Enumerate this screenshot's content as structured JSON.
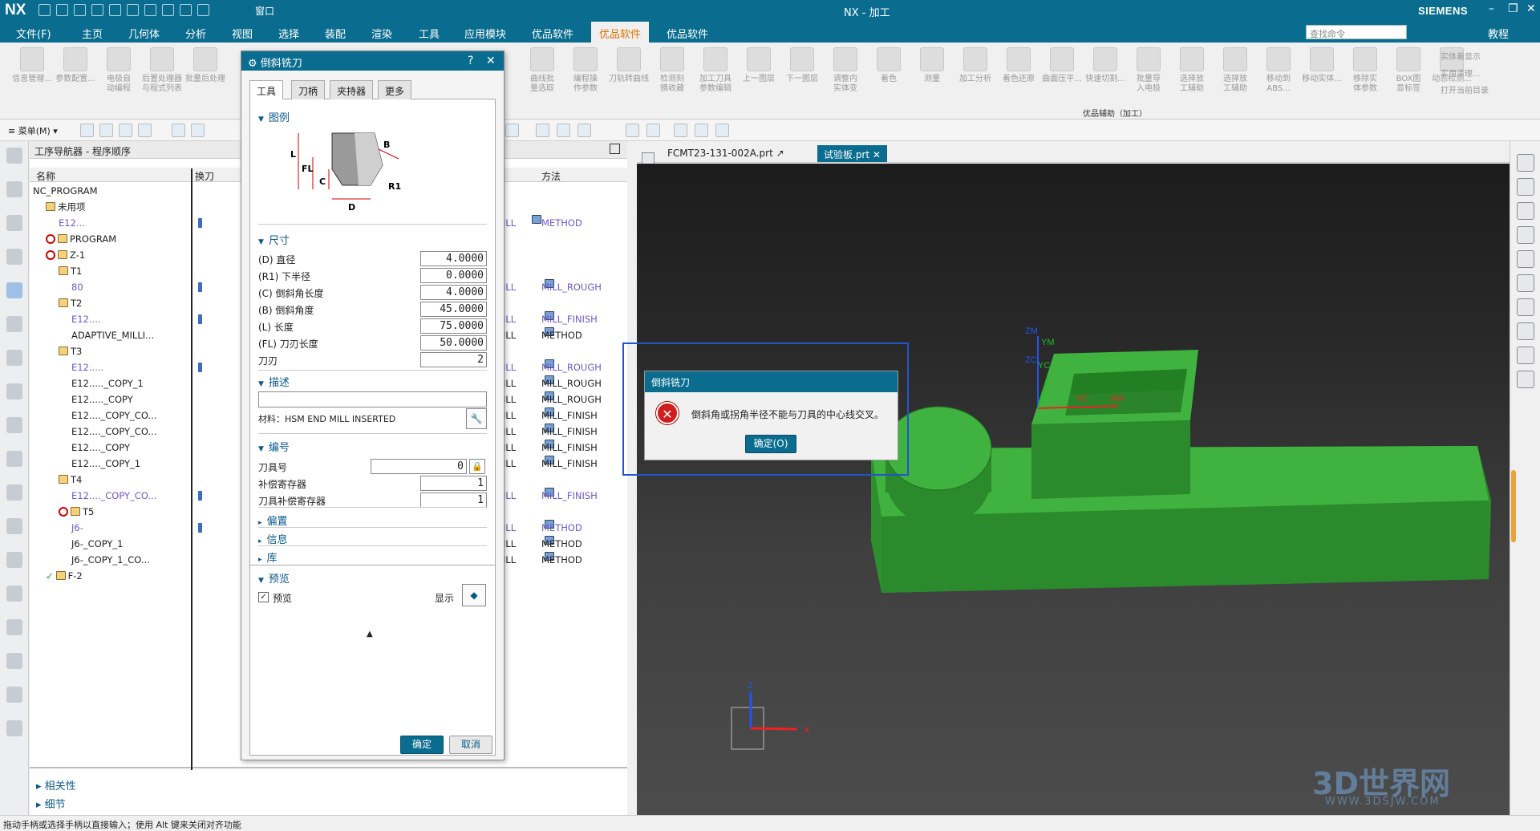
{
  "titlebar": {
    "logo": "NX",
    "window_menu": "窗口",
    "app_title": "NX - 加工",
    "brand": "SIEMENS"
  },
  "menubar": {
    "items": [
      "文件(F)",
      "主页",
      "几何体",
      "分析",
      "视图",
      "选择",
      "装配",
      "渲染",
      "工具",
      "应用模块",
      "优品软件",
      "优品软件",
      "优品软件"
    ],
    "search_placeholder": "查找命令",
    "tutorial": "教程"
  },
  "ribbon": {
    "left_buttons": [
      {
        "label": "信息管理..."
      },
      {
        "label": "参数配置..."
      },
      {
        "label": "电极自\n动编程"
      },
      {
        "label": "后置处理器\n与程式列表"
      },
      {
        "label": "批量后处理"
      }
    ],
    "right_buttons": [
      {
        "label": "曲线批\n量选取"
      },
      {
        "label": "编程操\n作参数"
      },
      {
        "label": "刀轨转曲线"
      },
      {
        "label": "检测刻\n摘收藏"
      },
      {
        "label": "加工刀具\n参数编辑"
      },
      {
        "label": "上一图层"
      },
      {
        "label": "下一图层"
      },
      {
        "label": "调整内\n实体变"
      },
      {
        "label": "着色"
      },
      {
        "label": "测量"
      },
      {
        "label": "加工分析"
      },
      {
        "label": "着色还原"
      },
      {
        "label": "曲面压平..."
      },
      {
        "label": "快速切割..."
      },
      {
        "label": "批量导\n入电极"
      },
      {
        "label": "选择放\n工辅助"
      },
      {
        "label": "选择放\n工辅助"
      },
      {
        "label": "移动到ABS..."
      },
      {
        "label": "移动实体..."
      },
      {
        "label": "移除实\n体参数"
      },
      {
        "label": "BOX图\n显标签"
      },
      {
        "label": "动态检测..."
      }
    ],
    "side_items": [
      "实体着显示",
      "实用清理...",
      "打开当前目录"
    ],
    "group_label": "优品辅助（加工）"
  },
  "toolbar2": {
    "menu_label": "菜单(M)"
  },
  "navigator": {
    "title": "工序导航器 - 程序顺序",
    "col_name": "名称",
    "col_toolchange": "换刀",
    "col_method": "方法",
    "rows": [
      {
        "indent": 0,
        "name": "NC_PROGRAM",
        "icon": "none",
        "op": "",
        "method": ""
      },
      {
        "indent": 1,
        "name": "未用项",
        "icon": "folder",
        "op": "",
        "method": ""
      },
      {
        "indent": 2,
        "name": "E12...",
        "icon": "op",
        "blue": true,
        "tc": true,
        "op": "ILL",
        "method": "METHOD",
        "mblue": true
      },
      {
        "indent": 1,
        "name": "PROGRAM",
        "icon": "stopfolder",
        "op": "",
        "method": ""
      },
      {
        "indent": 1,
        "name": "Z-1",
        "icon": "stopfolder",
        "op": "",
        "method": ""
      },
      {
        "indent": 2,
        "name": "T1",
        "icon": "folder",
        "op": "",
        "method": ""
      },
      {
        "indent": 3,
        "name": "80",
        "icon": "op",
        "blue": true,
        "tc": true,
        "op": "ILL",
        "method": "MILL_ROUGH",
        "mblue": true
      },
      {
        "indent": 2,
        "name": "T2",
        "icon": "folder",
        "op": "",
        "method": ""
      },
      {
        "indent": 3,
        "name": "E12....",
        "icon": "op",
        "blue": true,
        "tc": true,
        "op": "ILL",
        "method": "MILL_FINISH",
        "mblue": true
      },
      {
        "indent": 3,
        "name": "ADAPTIVE_MILLI...",
        "icon": "op",
        "op": "ILL",
        "method": "METHOD"
      },
      {
        "indent": 2,
        "name": "T3",
        "icon": "folder",
        "op": "",
        "method": ""
      },
      {
        "indent": 3,
        "name": "E12.....",
        "icon": "op",
        "blue": true,
        "tc": true,
        "op": "ILL",
        "method": "MILL_ROUGH",
        "mblue": true
      },
      {
        "indent": 3,
        "name": "E12....._COPY_1",
        "icon": "op",
        "op": "ILL",
        "method": "MILL_ROUGH"
      },
      {
        "indent": 3,
        "name": "E12....._COPY",
        "icon": "op",
        "op": "ILL",
        "method": "MILL_ROUGH"
      },
      {
        "indent": 3,
        "name": "E12...._COPY_CO...",
        "icon": "op",
        "op": "ILL",
        "method": "MILL_FINISH"
      },
      {
        "indent": 3,
        "name": "E12...._COPY_CO...",
        "icon": "op",
        "op": "ILL",
        "method": "MILL_FINISH"
      },
      {
        "indent": 3,
        "name": "E12...._COPY",
        "icon": "op",
        "op": "ILL",
        "method": "MILL_FINISH"
      },
      {
        "indent": 3,
        "name": "E12...._COPY_1",
        "icon": "op",
        "op": "ILL",
        "method": "MILL_FINISH"
      },
      {
        "indent": 2,
        "name": "T4",
        "icon": "folder",
        "op": "",
        "method": ""
      },
      {
        "indent": 3,
        "name": "E12...._COPY_CO...",
        "icon": "op",
        "blue": true,
        "tc": true,
        "op": "ILL",
        "method": "MILL_FINISH",
        "mblue": true
      },
      {
        "indent": 2,
        "name": "T5",
        "icon": "stopfolder",
        "op": "",
        "method": ""
      },
      {
        "indent": 3,
        "name": "J6-",
        "icon": "op",
        "blue": true,
        "tc": true,
        "op": "ILL",
        "method": "METHOD",
        "mblue": true
      },
      {
        "indent": 3,
        "name": "J6-_COPY_1",
        "icon": "op",
        "op": "ILL",
        "method": "METHOD"
      },
      {
        "indent": 3,
        "name": "J6-_COPY_1_CO...",
        "icon": "op",
        "op": "ILL",
        "method": "METHOD"
      },
      {
        "indent": 1,
        "name": "F-2",
        "icon": "checkfolder",
        "op": "",
        "method": ""
      }
    ],
    "footer_dependency": "相关性",
    "footer_details": "细节"
  },
  "dialog": {
    "title": "倒斜铣刀",
    "tabs": [
      "工具",
      "刀柄",
      "夹持器",
      "更多"
    ],
    "sec_legend": "图例",
    "sec_dimensions": "尺寸",
    "fields": [
      {
        "label": "(D) 直径",
        "value": "4.0000"
      },
      {
        "label": "(R1) 下半径",
        "value": "0.0000"
      },
      {
        "label": "(C) 倒斜角长度",
        "value": "4.0000"
      },
      {
        "label": "(B) 倒斜角度",
        "value": "45.0000"
      },
      {
        "label": "(L) 长度",
        "value": "75.0000"
      },
      {
        "label": "(FL) 刀刃长度",
        "value": "50.0000"
      },
      {
        "label": "刀刃",
        "value": "2"
      }
    ],
    "sec_description": "描述",
    "material": "材料：HSM END MILL INSERTED",
    "sec_numbering": "编号",
    "num_fields": [
      {
        "label": "刀具号",
        "value": "0"
      },
      {
        "label": "补偿寄存器",
        "value": "1"
      },
      {
        "label": "刀具补偿寄存器",
        "value": "1"
      }
    ],
    "sec_offset": "偏置",
    "sec_info": "信息",
    "sec_library": "库",
    "sec_preview": "预览",
    "preview_check": "预览",
    "show_label": "显示",
    "ok": "确定",
    "cancel": "取消",
    "legend_labels": {
      "B": "B",
      "L": "L",
      "FL": "FL",
      "C": "C",
      "R1": "R1",
      "D": "D"
    }
  },
  "viewport": {
    "tabs": [
      "FCMT23-131-002A.prt",
      "试验板.prt"
    ],
    "axis_labels": {
      "zm": "ZM",
      "ym": "YM",
      "zc": "ZC",
      "yc": "YC",
      "xm": "XM",
      "xc": "XC"
    },
    "mini_axis": {
      "z": "Z",
      "x": "X"
    }
  },
  "error_dialog": {
    "title": "倒斜铣刀",
    "message": "倒斜角或拐角半径不能与刀具的中心线交叉。",
    "ok": "确定(O)"
  },
  "watermark": {
    "text": "3D世界网",
    "url": "WWW.3DSJW.COM"
  },
  "status": "拖动手柄或选择手柄以直接输入；使用 Alt 键来关闭对齐功能",
  "colors": {
    "titlebar": "#0a6d8f",
    "accent": "#e27300",
    "model_green": "#3aa23a",
    "error_red": "#d11d1d"
  }
}
